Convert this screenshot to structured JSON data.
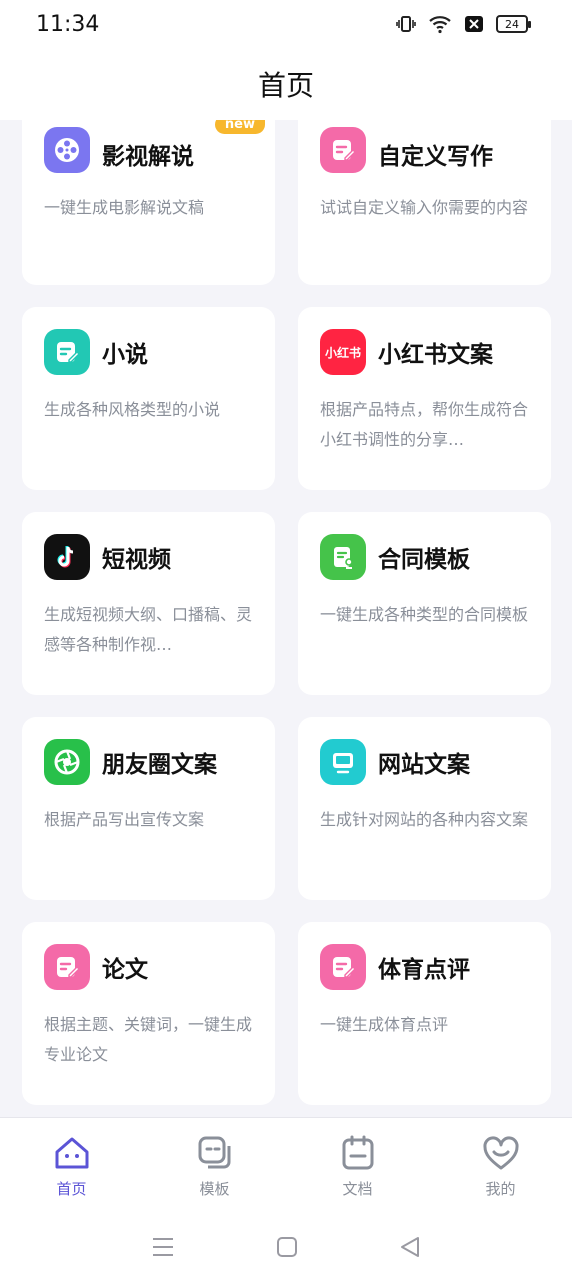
{
  "status": {
    "time": "11:34",
    "battery": "24"
  },
  "header": {
    "title": "首页"
  },
  "cards": [
    {
      "title": "影视解说",
      "desc": "一键生成电影解说文稿",
      "badge": "new",
      "icon": "film-reel-icon",
      "color": "#7b76f0"
    },
    {
      "title": "自定义写作",
      "desc": "试试自定义输入你需要的内容",
      "icon": "pen-note-icon",
      "color": "#f46aa8"
    },
    {
      "title": "小说",
      "desc": "生成各种风格类型的小说",
      "icon": "note-edit-icon",
      "color": "#22c8b4"
    },
    {
      "title": "小红书文案",
      "desc": "根据产品特点，帮你生成符合小红书调性的分享…",
      "icon": "xiaohongshu-logo-icon",
      "iconText": "小红书",
      "color": "#ff2442"
    },
    {
      "title": "短视频",
      "desc": "生成短视频大纲、口播稿、灵感等各种制作视…",
      "icon": "tiktok-logo-icon",
      "color": "#111111"
    },
    {
      "title": "合同模板",
      "desc": "一键生成各种类型的合同模板",
      "icon": "contract-icon",
      "color": "#45c34a"
    },
    {
      "title": "朋友圈文案",
      "desc": "根据产品写出宣传文案",
      "icon": "camera-aperture-icon",
      "color": "#28c04a"
    },
    {
      "title": "网站文案",
      "desc": "生成针对网站的各种内容文案",
      "icon": "monitor-icon",
      "color": "#22cbd0"
    },
    {
      "title": "论文",
      "desc": "根据主题、关键词，一键生成专业论文",
      "icon": "paper-edit-icon",
      "color": "#f46aa8"
    },
    {
      "title": "体育点评",
      "desc": "一键生成体育点评",
      "icon": "sports-comment-icon",
      "color": "#f46aa8"
    }
  ],
  "tabs": [
    {
      "label": "首页",
      "icon": "home-icon",
      "active": true
    },
    {
      "label": "模板",
      "icon": "template-icon",
      "active": false
    },
    {
      "label": "文档",
      "icon": "document-icon",
      "active": false
    },
    {
      "label": "我的",
      "icon": "profile-heart-icon",
      "active": false
    }
  ],
  "colors": {
    "accent": "#5b54d6",
    "muted": "#8a8f99"
  }
}
